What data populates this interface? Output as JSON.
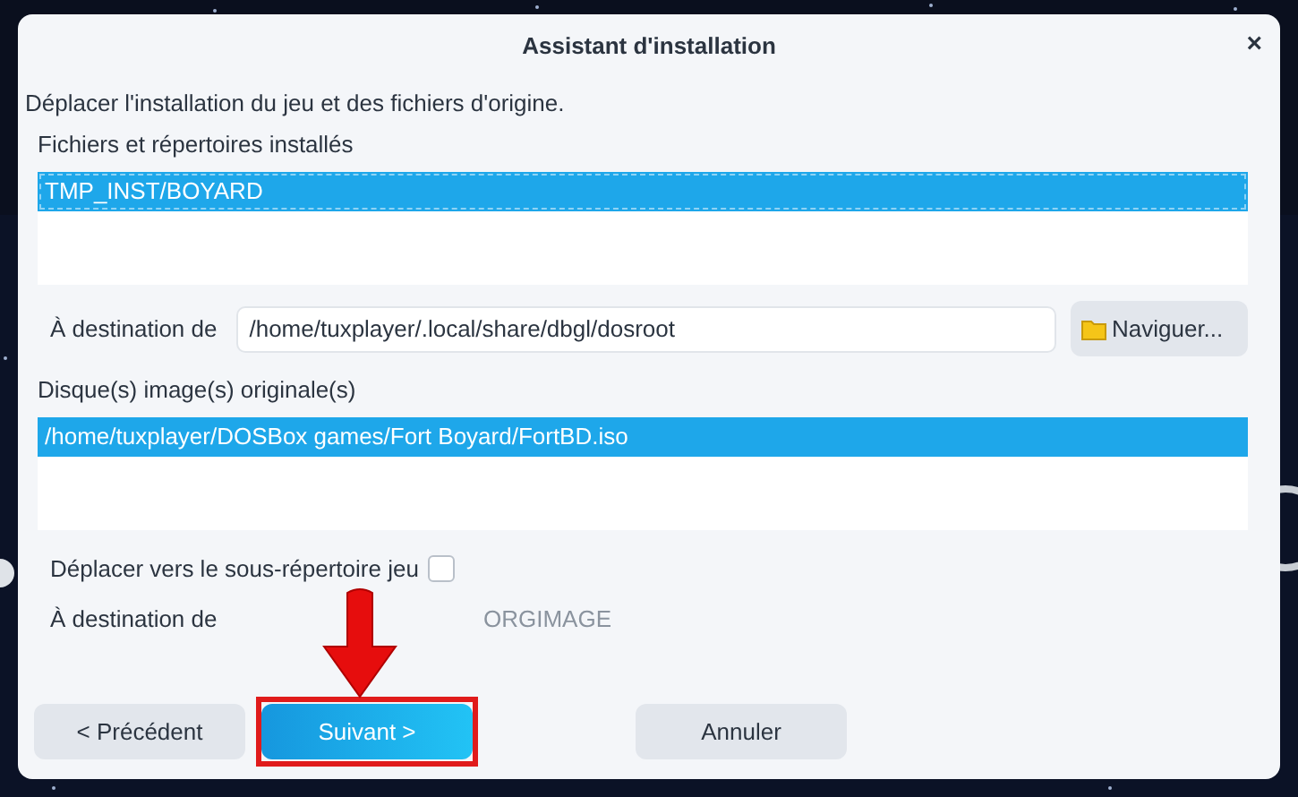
{
  "window": {
    "title": "Assistant d'installation",
    "close": "×"
  },
  "intro": "Déplacer l'installation du jeu et des fichiers d'origine.",
  "installed": {
    "label": "Fichiers et répertoires installés",
    "items": [
      {
        "text": "TMP_INST/BOYARD",
        "selected": true
      }
    ]
  },
  "destination": {
    "label": "À destination de",
    "value": "/home/tuxplayer/.local/share/dbgl/dosroot",
    "browse": "Naviguer..."
  },
  "images": {
    "label": "Disque(s) image(s) originale(s)",
    "items": [
      {
        "text": "/home/tuxplayer/DOSBox games/Fort Boyard/FortBD.iso",
        "selected": true
      }
    ]
  },
  "subdir": {
    "label": "Déplacer vers le sous-répertoire jeu",
    "checked": false
  },
  "image_destination": {
    "label": "À destination de",
    "value": "ORGIMAGE",
    "disabled": true
  },
  "buttons": [
    {
      "label": "< Précédent",
      "kind": "default",
      "highlighted": false
    },
    {
      "label": "Suivant >",
      "kind": "primary",
      "highlighted": true
    },
    {
      "label": "Annuler",
      "kind": "default",
      "highlighted": false
    }
  ]
}
